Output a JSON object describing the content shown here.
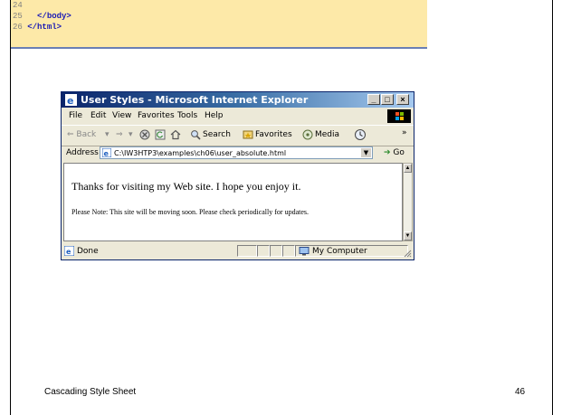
{
  "code_lines": [
    {
      "num": "24",
      "text": ""
    },
    {
      "num": "25",
      "text": "   </body>"
    },
    {
      "num": "26",
      "text": "</html>"
    }
  ],
  "window": {
    "title": "User Styles - Microsoft Internet Explorer",
    "menu": [
      "File",
      "Edit",
      "View",
      "Favorites",
      "Tools",
      "Help"
    ],
    "toolbar": {
      "back": "⇐ Back",
      "search": "Search",
      "favorites": "Favorites",
      "media": "Media",
      "more": "»"
    },
    "address": {
      "label": "Address",
      "value": "C:\\IW3HTP3\\examples\\ch06\\user_absolute.html",
      "go": "Go"
    },
    "content": {
      "line1": "Thanks for visiting my Web site. I hope you enjoy it.",
      "line2": "Please Note: This site will be moving soon. Please check periodically for updates."
    },
    "status": {
      "text": "Done",
      "zone": "My Computer"
    }
  },
  "footer": {
    "title": "Cascading Style Sheet",
    "page": "46"
  }
}
